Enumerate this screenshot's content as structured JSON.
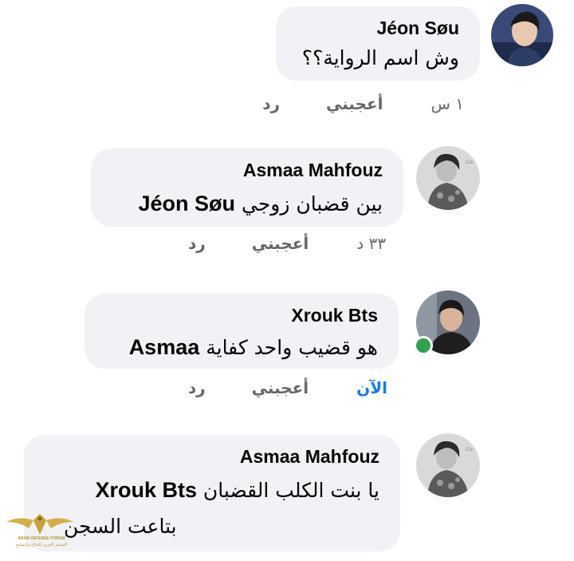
{
  "comments": [
    {
      "author": "Jéon Søu",
      "message_text": "وش اسم الرواية؟؟",
      "mention": "",
      "time": "١ س",
      "like_label": "أعجبني",
      "reply_label": "رد",
      "online": false
    },
    {
      "author": "Asmaa Mahfouz",
      "message_text": "بين قضبان زوجي",
      "mention": "Jéon Søu",
      "time": "٣٣ د",
      "like_label": "أعجبني",
      "reply_label": "رد",
      "online": false
    },
    {
      "author": "Xrouk Bts",
      "message_text": "هو قضيب واحد كفاية",
      "mention": "Asmaa",
      "time": "الآن",
      "like_label": "أعجبني",
      "reply_label": "رد",
      "online": true
    },
    {
      "author": "Asmaa Mahfouz",
      "message_text": "يا بنت الكلب القضبان",
      "mention": "Xrouk Bts",
      "message_line2": "بتاعت السجن",
      "time": "",
      "like_label": "",
      "reply_label": "",
      "online": false
    }
  ],
  "watermark": {
    "line1": "ARAB DEFENSE FORUM",
    "line2": "المنتدى العربي للدفاع والتسليح"
  },
  "colors": {
    "bubble": "#f0f2f5",
    "meta_text": "#65676b",
    "now_text": "#1877f2",
    "online_dot": "#31a24c"
  }
}
